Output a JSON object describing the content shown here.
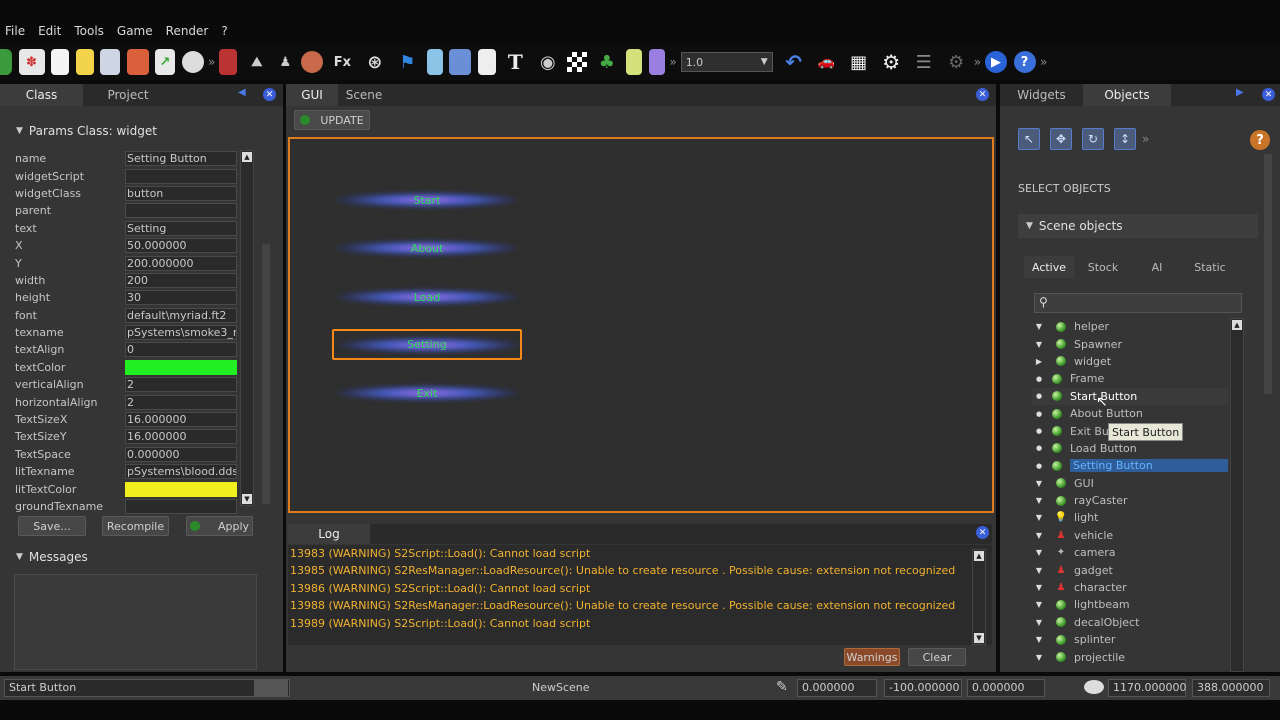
{
  "menu": [
    "File",
    "Edit",
    "Tools",
    "Game",
    "Render",
    "?"
  ],
  "toolbar": {
    "fx_label": "Fx",
    "text_label": "T",
    "combo_value": "1.0",
    "overflow": "»"
  },
  "left_panel": {
    "tabs": [
      "Class",
      "Project"
    ],
    "params_header": "Params Class: widget",
    "params": [
      {
        "name": "name",
        "value": "Setting Button"
      },
      {
        "name": "widgetScript",
        "value": ""
      },
      {
        "name": "widgetClass",
        "value": "button"
      },
      {
        "name": "parent",
        "value": ""
      },
      {
        "name": "text",
        "value": "Setting"
      },
      {
        "name": "X",
        "value": "50.000000"
      },
      {
        "name": "Y",
        "value": "200.000000"
      },
      {
        "name": "width",
        "value": "200"
      },
      {
        "name": "height",
        "value": "30"
      },
      {
        "name": "font",
        "value": "default\\myriad.ft2"
      },
      {
        "name": "texname",
        "value": "pSystems\\smoke3_n."
      },
      {
        "name": "textAlign",
        "value": "0"
      },
      {
        "name": "textColor",
        "value": "",
        "color": "#22ee22"
      },
      {
        "name": "verticalAlign",
        "value": "2"
      },
      {
        "name": "horizontalAlign",
        "value": "2"
      },
      {
        "name": "TextSizeX",
        "value": "16.000000"
      },
      {
        "name": "TextSizeY",
        "value": "16.000000"
      },
      {
        "name": "TextSpace",
        "value": "0.000000"
      },
      {
        "name": "litTexname",
        "value": "pSystems\\blood.dds"
      },
      {
        "name": "litTextColor",
        "value": "",
        "color": "#f0f01e"
      },
      {
        "name": "groundTexname",
        "value": ""
      }
    ],
    "save_label": "Save...",
    "recompile_label": "Recompile",
    "apply_label": "Apply",
    "messages_header": "Messages"
  },
  "center_panel": {
    "tabs": [
      "GUI",
      "Scene"
    ],
    "update_label": "UPDATE",
    "gui_buttons": [
      "Start",
      "About",
      "Load",
      "Setting",
      "Exit"
    ],
    "selected_button": "Setting",
    "log_tab": "Log",
    "log_lines": [
      "13983 (WARNING) S2Script::Load(): Cannot load script",
      "13985 (WARNING) S2ResManager::LoadResource(): Unable to create resource  . Possible cause: extension not recognized",
      "13986 (WARNING) S2Script::Load(): Cannot load script",
      "13988 (WARNING) S2ResManager::LoadResource(): Unable to create resource  . Possible cause: extension not recognized",
      "13989 (WARNING) S2Script::Load(): Cannot load script"
    ],
    "warnings_label": "Warnings",
    "clear_label": "Clear"
  },
  "right_panel": {
    "tabs": [
      "Widgets",
      "Objects"
    ],
    "select_objects": "SELECT OBJECTS",
    "scene_objects_header": "Scene objects",
    "sub_tabs": [
      "Active",
      "Stock",
      "AI",
      "Static"
    ],
    "search_placeholder": "",
    "tree": [
      {
        "label": "helper",
        "level": 0,
        "expander": "▼",
        "icon": "green-sphere-icon"
      },
      {
        "label": "Spawner",
        "level": 0,
        "expander": "▼",
        "icon": "green-sphere-icon"
      },
      {
        "label": "widget",
        "level": 0,
        "expander": "▶",
        "icon": "green-sphere-icon"
      },
      {
        "label": "Frame",
        "level": 1,
        "icon": "green-sphere-icon"
      },
      {
        "label": "Start Button",
        "level": 1,
        "icon": "green-sphere-icon",
        "hover": true
      },
      {
        "label": "About Button",
        "level": 1,
        "icon": "green-sphere-icon"
      },
      {
        "label": "Exit Bu",
        "level": 1,
        "icon": "green-sphere-icon"
      },
      {
        "label": "Load Button",
        "level": 1,
        "icon": "green-sphere-icon"
      },
      {
        "label": "Setting Button",
        "level": 1,
        "icon": "green-sphere-icon",
        "selected": true
      },
      {
        "label": "GUI",
        "level": 0,
        "expander": "▼",
        "icon": "green-sphere-icon"
      },
      {
        "label": "rayCaster",
        "level": 0,
        "expander": "▼",
        "icon": "green-sphere-icon"
      },
      {
        "label": "light",
        "level": 0,
        "expander": "▼",
        "icon": "bulb-icon"
      },
      {
        "label": "vehicle",
        "level": 0,
        "expander": "▼",
        "icon": "red-figure-icon"
      },
      {
        "label": "camera",
        "level": 0,
        "expander": "▼",
        "icon": "camera-icon"
      },
      {
        "label": "gadget",
        "level": 0,
        "expander": "▼",
        "icon": "red-figure-icon"
      },
      {
        "label": "character",
        "level": 0,
        "expander": "▼",
        "icon": "red-figure-icon"
      },
      {
        "label": "lightbeam",
        "level": 0,
        "expander": "▼",
        "icon": "green-sphere-icon"
      },
      {
        "label": "decalObject",
        "level": 0,
        "expander": "▼",
        "icon": "green-sphere-icon"
      },
      {
        "label": "splinter",
        "level": 0,
        "expander": "▼",
        "icon": "green-sphere-icon"
      },
      {
        "label": "projectile",
        "level": 0,
        "expander": "▼",
        "icon": "green-sphere-icon"
      }
    ],
    "tooltip": "Start Button"
  },
  "statusbar": {
    "selected": "Start Button",
    "scene": "NewScene",
    "pos_x": "0.000000",
    "pos_y": "-100.000000",
    "pos_z": "0.000000",
    "res_w": "1170.000000",
    "res_h": "388.000000"
  },
  "colors": {
    "selection_orange": "#e07b1d",
    "log_warning": "#f1b230",
    "gui_text": "#2fdc5a",
    "accent_blue": "#3a5ed8"
  }
}
